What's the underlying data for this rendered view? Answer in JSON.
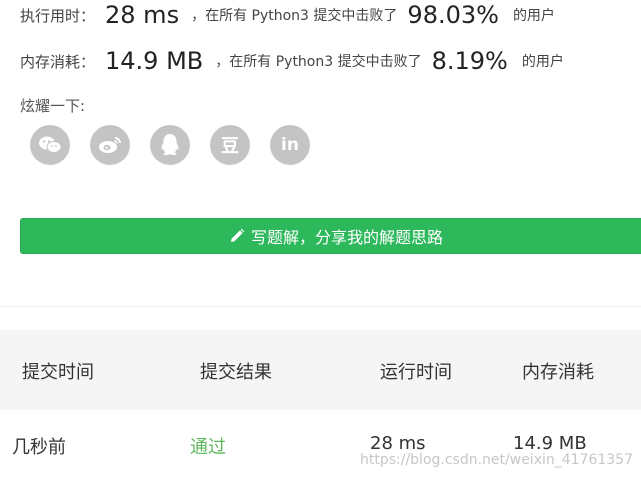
{
  "stats": {
    "runtime": {
      "label": "执行用时：",
      "value": "28 ms",
      "middle": "，在所有 Python3 提交中击败了",
      "percent": "98.03%",
      "suffix": "的用户"
    },
    "memory": {
      "label": "内存消耗：",
      "value": "14.9 MB",
      "middle": "，在所有 Python3 提交中击败了",
      "percent": "8.19%",
      "suffix": "的用户"
    }
  },
  "share": {
    "label": "炫耀一下:",
    "icons": [
      "wechat-icon",
      "weibo-icon",
      "qq-icon",
      "douban-icon",
      "linkedin-icon"
    ],
    "douban_glyph": "豆",
    "linkedin_glyph": "in"
  },
  "solution_button": {
    "label": "写题解，分享我的解题思路",
    "color": "#2eb85c"
  },
  "table": {
    "headers": [
      "提交时间",
      "提交结果",
      "运行时间",
      "内存消耗"
    ],
    "rows": [
      {
        "time": "几秒前",
        "result": "通过",
        "runtime": "28 ms",
        "memory": "14.9 MB"
      }
    ],
    "pass_color": "#5cb85c"
  },
  "watermark": "https://blog.csdn.net/weixin_41761357"
}
